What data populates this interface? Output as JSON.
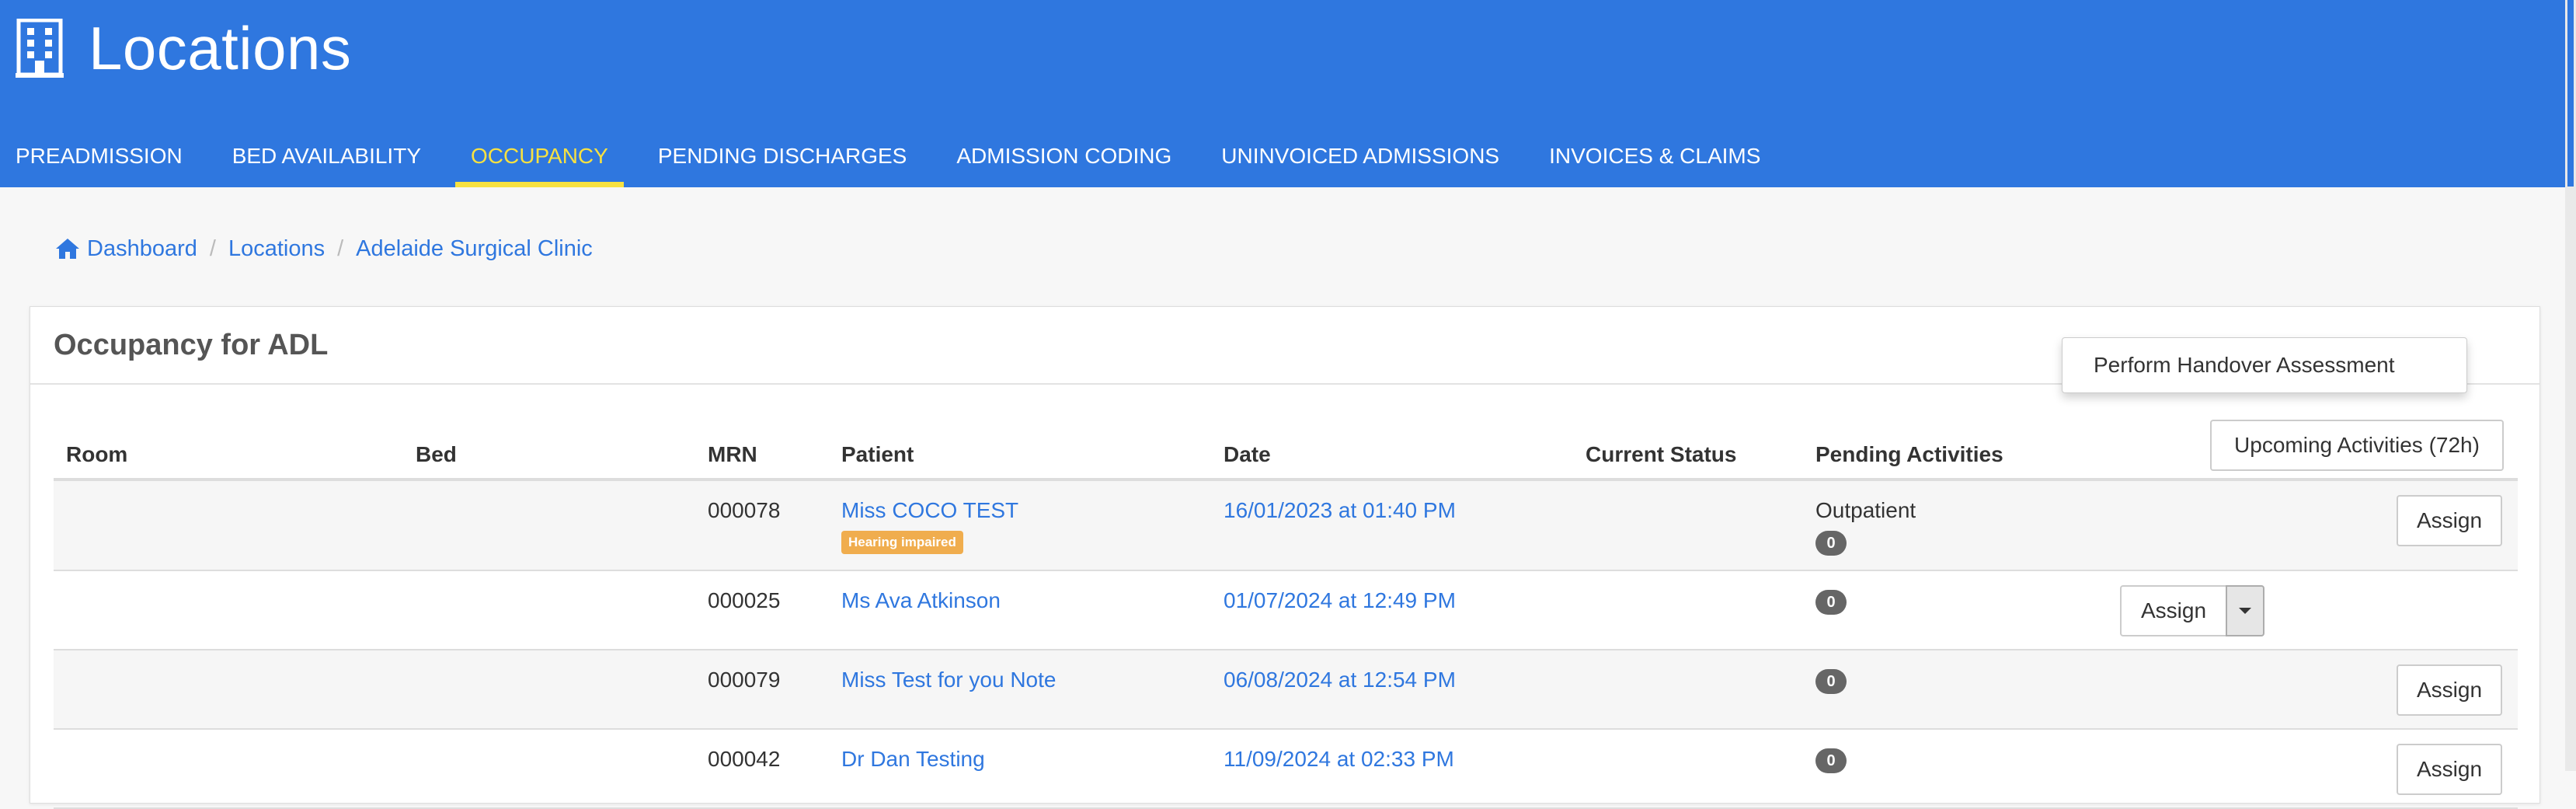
{
  "header": {
    "title": "Locations",
    "icon": "building-icon",
    "tabs": [
      {
        "label": "PREADMISSION",
        "active": false
      },
      {
        "label": "BED AVAILABILITY",
        "active": false
      },
      {
        "label": "OCCUPANCY",
        "active": true
      },
      {
        "label": "PENDING DISCHARGES",
        "active": false
      },
      {
        "label": "ADMISSION CODING",
        "active": false
      },
      {
        "label": "UNINVOICED ADMISSIONS",
        "active": false
      },
      {
        "label": "INVOICES & CLAIMS",
        "active": false
      }
    ]
  },
  "breadcrumb": [
    "Dashboard",
    "Locations",
    "Adelaide Surgical Clinic"
  ],
  "panel": {
    "title": "Occupancy for ADL",
    "upcoming_button": "Upcoming Activities (72h)",
    "columns": [
      "Room",
      "Bed",
      "MRN",
      "Patient",
      "Date",
      "Current Status",
      "Pending Activities"
    ],
    "rows": [
      {
        "room": "",
        "bed": "",
        "mrn": "000078",
        "patient": "Miss COCO TEST",
        "tag": "Hearing impaired",
        "date": "16/01/2023 at 01:40 PM",
        "status": "",
        "pending_label": "Outpatient",
        "pending_count": "0",
        "action": "Assign"
      },
      {
        "room": "",
        "bed": "",
        "mrn": "000025",
        "patient": "Ms Ava Atkinson",
        "tag": "",
        "date": "01/07/2024 at 12:49 PM",
        "status": "",
        "pending_label": "",
        "pending_count": "0",
        "action": "Assign"
      },
      {
        "room": "",
        "bed": "",
        "mrn": "000079",
        "patient": "Miss Test for you Note",
        "tag": "",
        "date": "06/08/2024 at 12:54 PM",
        "status": "",
        "pending_label": "",
        "pending_count": "0",
        "action": "Assign"
      },
      {
        "room": "",
        "bed": "",
        "mrn": "000042",
        "patient": "Dr Dan Testing",
        "tag": "",
        "date": "11/09/2024 at 02:33 PM",
        "status": "",
        "pending_label": "",
        "pending_count": "0",
        "action": "Assign"
      }
    ],
    "dropdown_menu": [
      "Perform Handover Assessment"
    ]
  },
  "colors": {
    "header_bg": "#2f77df",
    "active_tab": "#f7e141",
    "link": "#2f77df",
    "tag": "#f0ad4e",
    "count_badge": "#666666"
  }
}
